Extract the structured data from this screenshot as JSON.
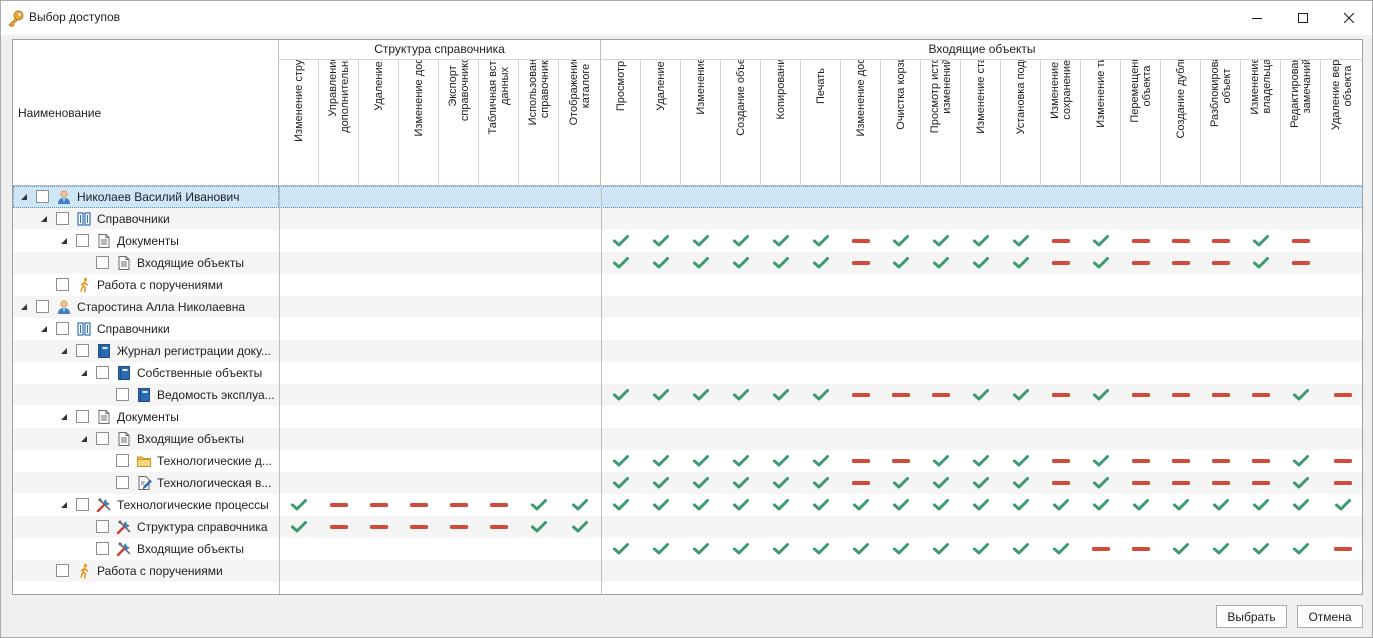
{
  "window": {
    "title": "Выбор доступов"
  },
  "header": {
    "name_label": "Наименование",
    "groups": [
      {
        "label": "Структура справочника"
      },
      {
        "label": "Входящие объекты"
      }
    ],
    "structure_columns": [
      "Изменение структуры",
      "Управление дополнительными",
      "Удаление",
      "Изменение доступа",
      "Экспорт справочников",
      "Табличная вставка данных",
      "Использование справочника",
      "Отображение в каталоге"
    ],
    "incoming_columns": [
      "Просмотр",
      "Удаление",
      "Изменение",
      "Создание объектов",
      "Копирование",
      "Печать",
      "Изменение доступа",
      "Очистка корзины",
      "Просмотр истории изменений",
      "Изменение стадии",
      "Установка подписи",
      "Изменение с сохранением",
      "Изменение типа",
      "Перемещение объекта",
      "Создание дубликата",
      "Разблокировать объект",
      "Изменение владельца",
      "Редактирование замечаний",
      "Удаление версии объекта"
    ]
  },
  "rows": [
    {
      "label": "Николаев Василий Иванович",
      "level": 0,
      "icon": "user-icon",
      "expander": true,
      "selected": true,
      "structure": "",
      "incoming": ""
    },
    {
      "label": "Справочники",
      "level": 1,
      "icon": "catalogs-icon",
      "expander": true,
      "structure": "",
      "incoming": ""
    },
    {
      "label": "Документы",
      "level": 2,
      "icon": "document-icon",
      "expander": true,
      "structure": "",
      "incoming": "yyyyyyn yyyy nynnnyn"
    },
    {
      "label": "Входящие объекты",
      "level": 3,
      "icon": "document-icon",
      "expander": false,
      "structure": "",
      "incoming": "yyyyyyn yyyy nynnnyn"
    },
    {
      "label": "Работа с поручениями",
      "level": 1,
      "icon": "walker-icon",
      "expander": false,
      "structure": "",
      "incoming": ""
    },
    {
      "label": "Старостина Алла Николаевна",
      "level": 0,
      "icon": "user-icon",
      "expander": true,
      "structure": "",
      "incoming": ""
    },
    {
      "label": "Справочники",
      "level": 1,
      "icon": "catalogs-icon",
      "expander": true,
      "structure": "",
      "incoming": ""
    },
    {
      "label": "Журнал регистрации доку...",
      "level": 2,
      "icon": "book-icon",
      "expander": true,
      "structure": "",
      "incoming": ""
    },
    {
      "label": "Собственные объекты",
      "level": 3,
      "icon": "book-icon",
      "expander": true,
      "structure": "",
      "incoming": ""
    },
    {
      "label": "Ведомость эксплуа...",
      "level": 4,
      "icon": "book-icon",
      "expander": false,
      "structure": "",
      "incoming": "yyyyyynnnyynynnnnyn"
    },
    {
      "label": "Документы",
      "level": 2,
      "icon": "document-icon",
      "expander": true,
      "structure": "",
      "incoming": ""
    },
    {
      "label": "Входящие объекты",
      "level": 3,
      "icon": "document-icon",
      "expander": true,
      "structure": "",
      "incoming": ""
    },
    {
      "label": "Технологические д...",
      "level": 4,
      "icon": "folder-icon",
      "expander": false,
      "structure": "",
      "incoming": "yyyyyynnyyynynnnnyn"
    },
    {
      "label": "Технологическая в...",
      "level": 4,
      "icon": "edit-doc-icon",
      "expander": false,
      "structure": "",
      "incoming": "yyyyyynyyyynynnnnyn"
    },
    {
      "label": "Технологические процессы",
      "level": 2,
      "icon": "tools-icon",
      "expander": true,
      "structure": "ynnnnnyy",
      "incoming": "yyyyyyyyyyyyyyyyyyy"
    },
    {
      "label": "Структура справочника",
      "level": 3,
      "icon": "tools-icon",
      "expander": false,
      "structure": "ynnnnnyy",
      "incoming": ""
    },
    {
      "label": "Входящие объекты",
      "level": 3,
      "icon": "tools-icon",
      "expander": false,
      "structure": "",
      "incoming": "yyyyyyyyyyyynnyyyyn"
    },
    {
      "label": "Работа с поручениями",
      "level": 1,
      "icon": "walker-icon",
      "expander": false,
      "structure": "",
      "incoming": ""
    }
  ],
  "buttons": {
    "ok": "Выбрать",
    "cancel": "Отмена"
  },
  "colors": {
    "check": "#3d9a6e",
    "deny": "#d24b3a",
    "selection": "#cfe6f7"
  }
}
